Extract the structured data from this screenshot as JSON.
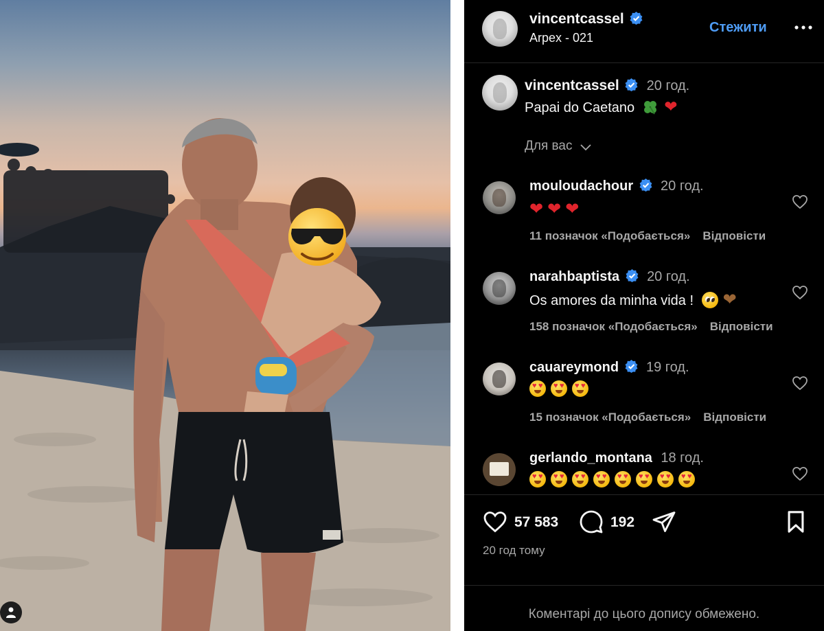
{
  "post": {
    "author": "vincentcassel",
    "location": "Arpex - 021",
    "follow_label": "Стежити",
    "caption_author": "vincentcassel",
    "caption_time": "20 год.",
    "caption_text": "Papai do Caetano",
    "caption_emojis": [
      "four-leaf-clover",
      "red-heart"
    ],
    "filter_label": "Для вас",
    "likes": "57 583",
    "comments_count": "192",
    "posted_ago": "20 год тому",
    "comments_notice": "Коментарі до цього допису обмежено."
  },
  "comments": [
    {
      "user": "mouloudachour",
      "verified": true,
      "time": "20 год.",
      "text": "",
      "emojis": [
        "red-heart",
        "red-heart",
        "red-heart"
      ],
      "likes": "11 позначок «Подобається»",
      "reply_label": "Відповісти"
    },
    {
      "user": "narahbaptista",
      "verified": true,
      "time": "20 год.",
      "text": "Os amores da minha vida !",
      "emojis": [
        "pleading-face",
        "brown-heart"
      ],
      "likes": "158 позначок «Подобається»",
      "reply_label": "Відповісти"
    },
    {
      "user": "cauareymond",
      "verified": true,
      "time": "19 год.",
      "text": "",
      "emojis": [
        "heart-eyes",
        "heart-eyes",
        "heart-eyes"
      ],
      "likes": "15 позначок «Подобається»",
      "reply_label": "Відповісти"
    },
    {
      "user": "gerlando_montana",
      "verified": false,
      "time": "18 год.",
      "text": "",
      "emojis": [
        "heart-eyes",
        "heart-eyes",
        "heart-eyes",
        "heart-eyes",
        "heart-eyes",
        "heart-eyes",
        "heart-eyes",
        "heart-eyes"
      ],
      "likes": "",
      "reply_label": ""
    }
  ],
  "colors": {
    "panel_bg": "#000000",
    "link_blue": "#4e9cf5",
    "verified_blue": "#3b8ff3",
    "muted_text": "#a8a8a8"
  }
}
